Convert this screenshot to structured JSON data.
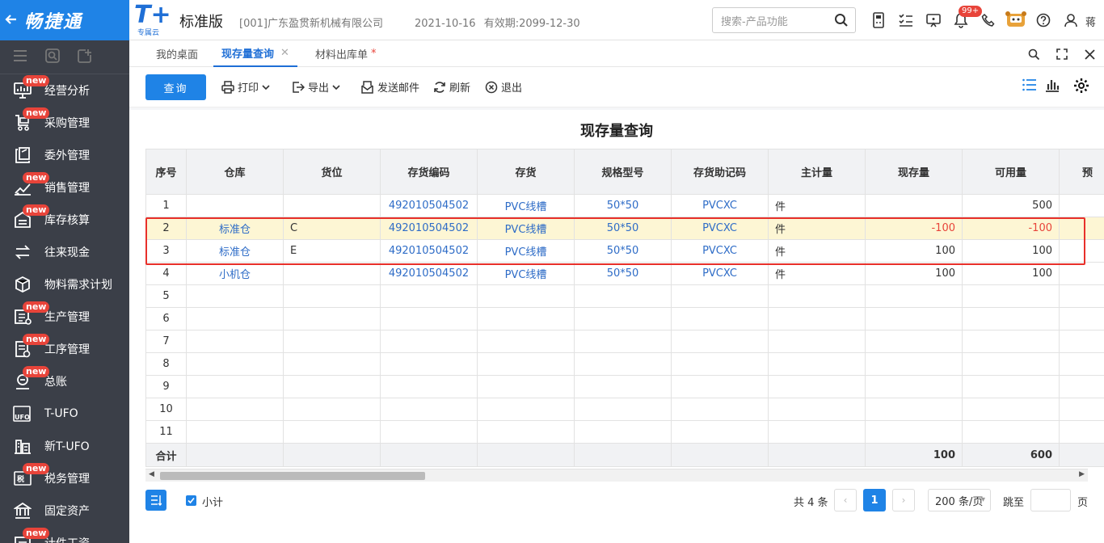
{
  "app": {
    "name": "畅捷通",
    "logo_text": "T+",
    "logo_sub": "专属云",
    "edition": "标准版",
    "company": "[001]广东盈贯新机械有限公司",
    "date": "2021-10-16",
    "validity": "有效期:2099-12-30",
    "user_partial": "蒋"
  },
  "search": {
    "placeholder": "搜索-产品功能"
  },
  "header_icons": {
    "notification_badge": "99+"
  },
  "sidebar": {
    "items": [
      {
        "label": "经营分析",
        "new": "new"
      },
      {
        "label": "采购管理",
        "new": "new"
      },
      {
        "label": "委外管理",
        "new": ""
      },
      {
        "label": "销售管理",
        "new": "new"
      },
      {
        "label": "库存核算",
        "new": "new"
      },
      {
        "label": "往来现金",
        "new": ""
      },
      {
        "label": "物料需求计划",
        "new": ""
      },
      {
        "label": "生产管理",
        "new": "new"
      },
      {
        "label": "工序管理",
        "new": "new"
      },
      {
        "label": "总账",
        "new": "new"
      },
      {
        "label": "T-UFO",
        "new": ""
      },
      {
        "label": "新T-UFO",
        "new": ""
      },
      {
        "label": "税务管理",
        "new": "new"
      },
      {
        "label": "固定资产",
        "new": ""
      },
      {
        "label": "计件工资",
        "new": "new"
      }
    ]
  },
  "tabs": [
    {
      "label": "我的桌面"
    },
    {
      "label": "现存量查询",
      "close": "✕"
    },
    {
      "label": "材料出库单",
      "star": "*"
    }
  ],
  "toolbar": {
    "query": "查询",
    "print": "打印",
    "export": "导出",
    "send_mail": "发送邮件",
    "refresh": "刷新",
    "exit": "退出"
  },
  "report": {
    "title": "现存量查询",
    "columns": [
      "序号",
      "仓库",
      "货位",
      "存货编码",
      "存货",
      "规格型号",
      "存货助记码",
      "主计量",
      "现存量",
      "可用量",
      "预"
    ],
    "rows": [
      {
        "no": "1",
        "warehouse": "",
        "location": "",
        "code": "492010504502",
        "item": "PVC线槽",
        "spec": "50*50",
        "mnemonic": "PVCXC",
        "unit": "件",
        "onhand": "",
        "available": "500"
      },
      {
        "no": "2",
        "warehouse": "标准仓",
        "location": "C",
        "code": "492010504502",
        "item": "PVC线槽",
        "spec": "50*50",
        "mnemonic": "PVCXC",
        "unit": "件",
        "onhand": "-100",
        "available": "-100"
      },
      {
        "no": "3",
        "warehouse": "标准仓",
        "location": "E",
        "code": "492010504502",
        "item": "PVC线槽",
        "spec": "50*50",
        "mnemonic": "PVCXC",
        "unit": "件",
        "onhand": "100",
        "available": "100"
      },
      {
        "no": "4",
        "warehouse": "小机仓",
        "location": "",
        "code": "492010504502",
        "item": "PVC线槽",
        "spec": "50*50",
        "mnemonic": "PVCXC",
        "unit": "件",
        "onhand": "100",
        "available": "100"
      }
    ],
    "empty_rows": [
      "5",
      "6",
      "7",
      "8",
      "9",
      "10",
      "11"
    ],
    "total": {
      "label": "合计",
      "onhand": "100",
      "available": "600"
    }
  },
  "footer": {
    "subtotal_label": "小计",
    "total_text": "共 4 条",
    "current_page": "1",
    "page_size": "200 条/页",
    "jump_label": "跳至",
    "page_unit": "页"
  },
  "colors": {
    "brand": "#1f83e6",
    "sidebar": "#3b3f48",
    "link": "#2e6cc7",
    "negative": "#e8443a",
    "highlight_row": "#fdf6d4",
    "annotation_box": "#e8302a"
  }
}
